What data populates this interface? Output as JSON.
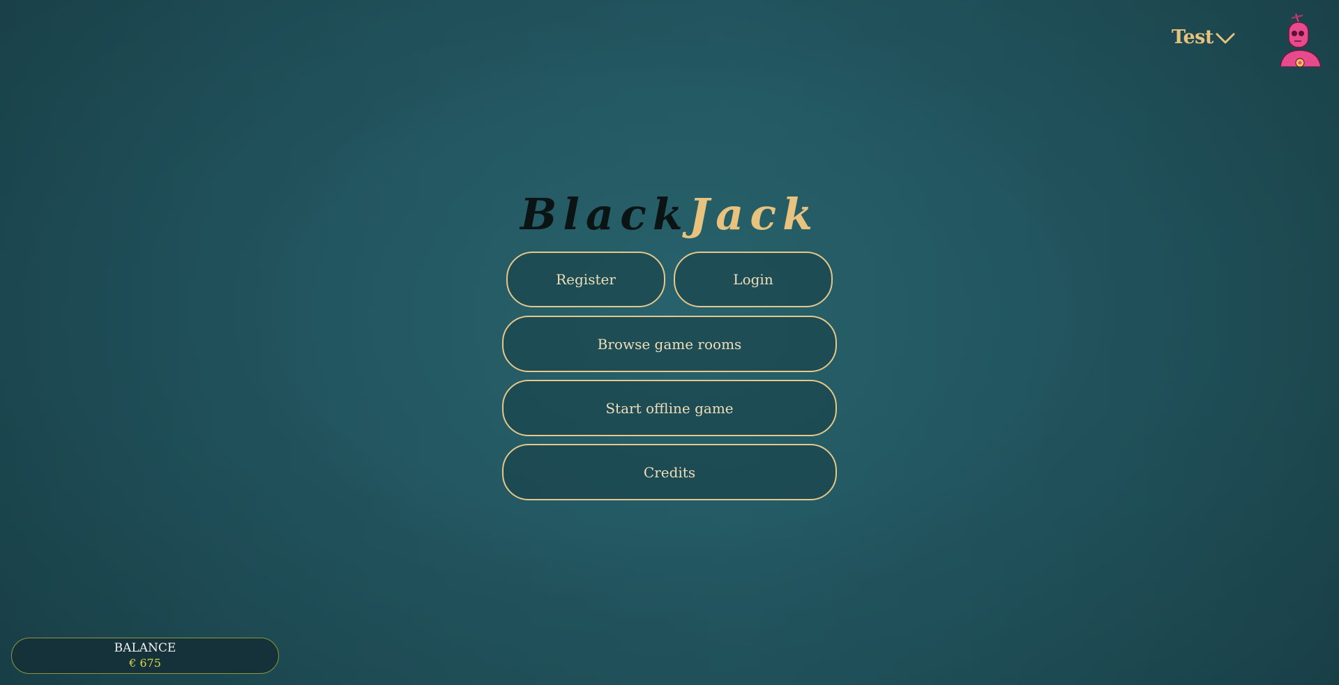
{
  "header": {
    "user_name": "Test",
    "menu_icon": "chevron-down-icon",
    "avatar_icon": "pink-robot-avatar-icon"
  },
  "title": {
    "part1": "Black",
    "part2": "Jack"
  },
  "menu": {
    "register_label": "Register",
    "login_label": "Login",
    "browse_label": "Browse game rooms",
    "offline_label": "Start offline game",
    "credits_label": "Credits"
  },
  "balance": {
    "label": "BALANCE",
    "amount": "€ 675"
  },
  "colors": {
    "accent_gold": "#e7c37f",
    "button_border": "#e6c98a",
    "background": "#245a64",
    "title_dark": "#0b1414",
    "balance_amount": "#d8d84a"
  }
}
